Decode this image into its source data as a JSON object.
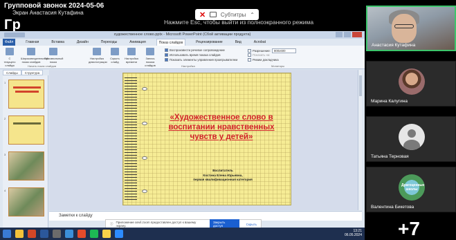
{
  "meeting": {
    "title": "Групповой звонок 2024-05-06",
    "subtitle": "Экран Анастасия Кутафина",
    "overlay_letters": "Гр",
    "esc_hint": "Нажмите Esc, чтобы выйти из полноэкранного режима",
    "subtitles_label": "Субтитры"
  },
  "ppt": {
    "window_title": "художественное слово.pptx - Microsoft PowerPoint (Сбой активации продукта)",
    "tabs": [
      "Файл",
      "Главная",
      "Вставка",
      "Дизайн",
      "Переходы",
      "Анимация",
      "Показ слайдов",
      "Рецензирование",
      "Вид",
      "Acrobat"
    ],
    "ribbon": {
      "buttons": [
        "С текущего слайда",
        "Широковещательный показ слайдов",
        "Произвольный показ",
        "Настройка демонстрации",
        "Скрыть слайд",
        "Настройка времени",
        "Запись показа слайдов"
      ],
      "checks": [
        "Воспроизвести речевое сопровождение",
        "Использовать время показа слайдов",
        "Показать элементы управления проигрывателем"
      ],
      "resolution_label": "Разрешение:",
      "resolution_value": "800x600",
      "show_on_label": "Показать на:",
      "presenter_view": "Режим докладчика",
      "group_start": "Начать показ слайдов",
      "group_setup": "Настройка",
      "group_monitors": "Мониторы"
    },
    "panel_tabs": [
      "Слайды",
      "Структура"
    ],
    "thumb_numbers": [
      "1",
      "2",
      "3",
      "4"
    ],
    "slide": {
      "title": "«Художественное слово в воспитании нравственных чувств у детей»",
      "author_line1": "Воспитатель",
      "author_line2": "Костина Елена Юрьевна,",
      "author_line3": "первая квалификационная категория"
    },
    "notes_placeholder": "Заметки к слайду",
    "status": "Слайд 1 из 15",
    "access_banner": {
      "text": "Приложение anvil.zoom предоставлен доступ к вашему экрану.",
      "stop_button": "Закрыть доступ",
      "hide_button": "Скрыть"
    },
    "clock_time": "13:21",
    "clock_date": "06.05.2024"
  },
  "participants": [
    {
      "name": "Анастасия Кутафина",
      "kind": "video"
    },
    {
      "name": "Марина Калугина",
      "kind": "photo"
    },
    {
      "name": "Татьяна Терновая",
      "kind": "generic"
    },
    {
      "name": "Валентина Бикетова",
      "kind": "school"
    }
  ],
  "school_avatar_text": "Драгоценные школы",
  "more_count": "+7",
  "colors": {
    "slide_bg": "#f6ec95",
    "slide_title": "#d2222a",
    "active_speaker_border": "#3cc56b",
    "file_tab": "#2a5ea8"
  }
}
